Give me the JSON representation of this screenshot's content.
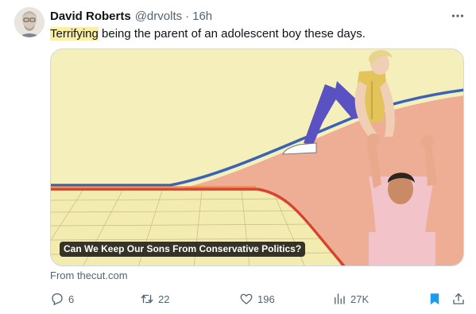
{
  "tweet": {
    "author_name": "David Roberts",
    "handle": "@drvolts",
    "separator": "·",
    "time": "16h",
    "text_highlighted": "Terrifying",
    "text_rest": " being the parent of an adolescent boy these days.",
    "highlight_color": "#fbefa3"
  },
  "card": {
    "title": "Can We Keep Our Sons From Conservative Politics?",
    "source": "From thecut.com"
  },
  "actions": {
    "replies": "6",
    "reposts": "22",
    "likes": "196",
    "views": "27K",
    "bookmark_color": "#1d9bf0"
  },
  "icons": {
    "more": "more-horizontal-icon",
    "reply": "reply-icon",
    "repost": "repost-icon",
    "like": "heart-icon",
    "views": "views-icon",
    "bookmark": "bookmark-icon",
    "share": "share-icon"
  }
}
